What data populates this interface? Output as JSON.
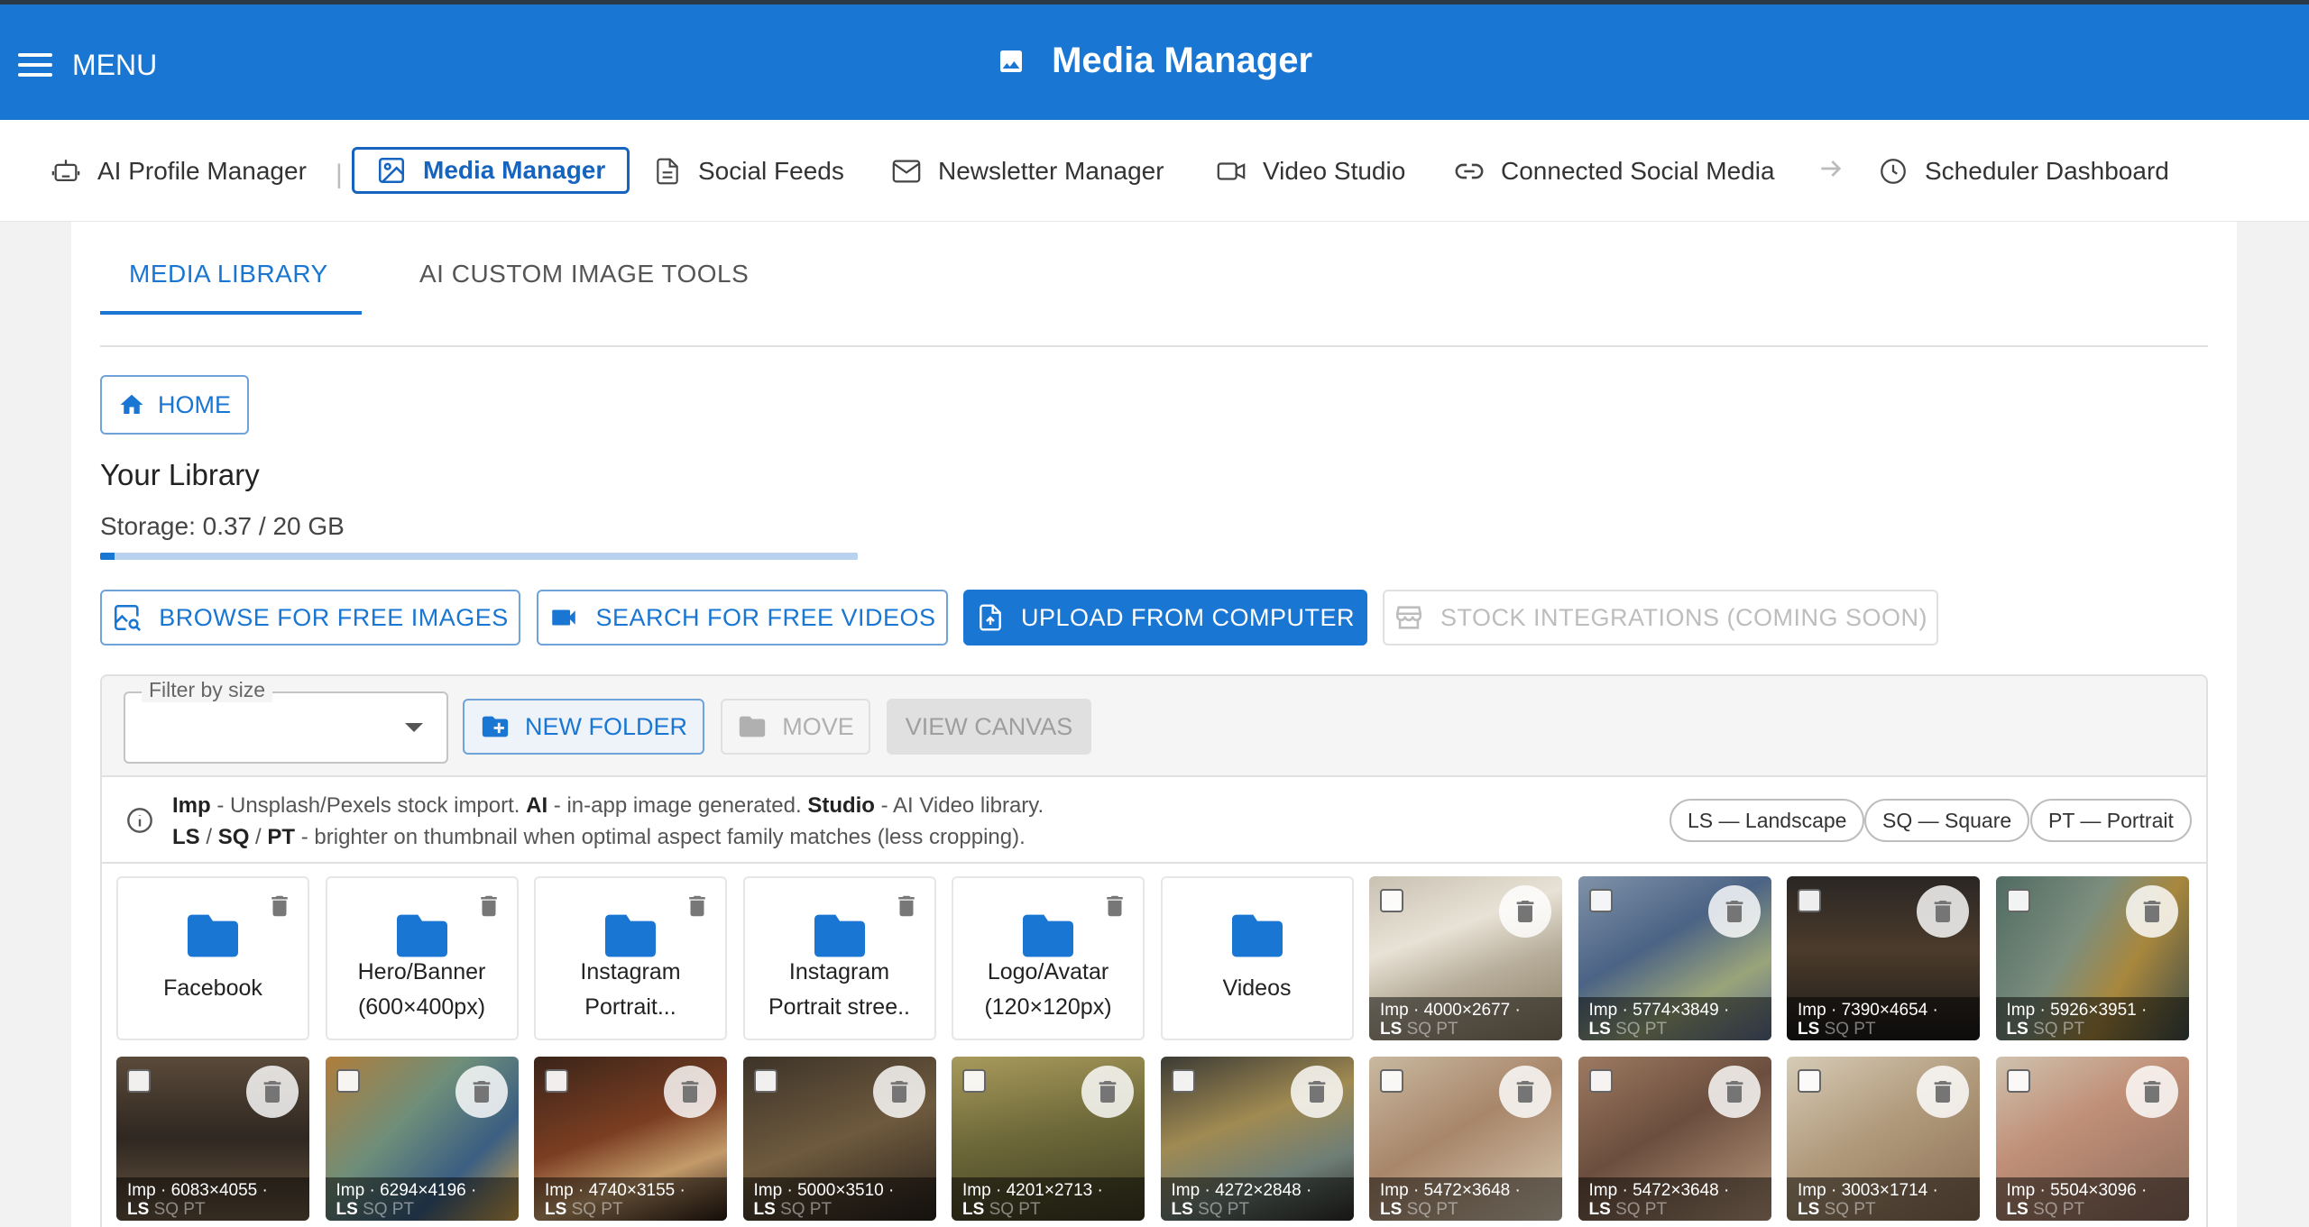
{
  "topbar": {
    "menu_label": "MENU",
    "title": "Media Manager"
  },
  "nav": {
    "items": [
      {
        "label": "AI Profile Manager",
        "icon": "robot-icon"
      },
      {
        "label": "Media Manager",
        "icon": "image-icon",
        "active": true
      },
      {
        "label": "Social Feeds",
        "icon": "document-icon"
      },
      {
        "label": "Newsletter Manager",
        "icon": "mail-icon"
      },
      {
        "label": "Video Studio",
        "icon": "video-camera-icon"
      },
      {
        "label": "Connected Social Media",
        "icon": "link-icon"
      },
      {
        "label": "Scheduler Dashboard",
        "icon": "clock-icon"
      }
    ]
  },
  "tabs": [
    {
      "label": "MEDIA LIBRARY",
      "active": true
    },
    {
      "label": "AI CUSTOM IMAGE TOOLS",
      "active": false
    }
  ],
  "home_label": "HOME",
  "library": {
    "title": "Your Library",
    "storage_text": "Storage: 0.37 / 20 GB",
    "storage_used_fraction": 0.0185
  },
  "actions": {
    "browse": "BROWSE FOR FREE IMAGES",
    "search_videos": "SEARCH FOR FREE VIDEOS",
    "upload": "UPLOAD FROM COMPUTER",
    "stock": "STOCK INTEGRATIONS (COMING SOON)"
  },
  "toolbar": {
    "filter_label": "Filter by size",
    "filter_value": "",
    "new_folder": "NEW FOLDER",
    "move": "MOVE",
    "view_canvas": "VIEW CANVAS"
  },
  "legend": {
    "imp": "Imp",
    "imp_desc": " - Unsplash/Pexels stock import. ",
    "ai": "AI",
    "ai_desc": " - in-app image generated. ",
    "studio": "Studio",
    "studio_desc": " - AI Video library.",
    "ls": "LS",
    "sep1": " / ",
    "sq": "SQ",
    "sep2": " / ",
    "pt": "PT",
    "fam_desc": " - brighter on thumbnail when optimal aspect family matches (less cropping).",
    "chips": [
      "LS — Landscape",
      "SQ — Square",
      "PT — Portrait"
    ]
  },
  "folders": [
    {
      "line1": "Facebook",
      "line2": ""
    },
    {
      "line1": "Hero/Banner",
      "line2": "(600×400px)"
    },
    {
      "line1": "Instagram",
      "line2": "Portrait..."
    },
    {
      "line1": "Instagram",
      "line2": "Portrait stree.."
    },
    {
      "line1": "Logo/Avatar",
      "line2": "(120×120px)"
    },
    {
      "line1": "Videos",
      "line2": ""
    }
  ],
  "images": [
    {
      "source": "Imp",
      "size": "4000×2677",
      "bg": "linear-gradient(160deg,#c9c1b2 0%,#e8e2d6 35%,#b7ad9a 60%,#8c7f66 100%)"
    },
    {
      "source": "Imp",
      "size": "5774×3849",
      "bg": "linear-gradient(150deg,#7f92a8 0%,#4b6385 40%,#9aa47a 70%,#5c6b8c 100%)"
    },
    {
      "source": "Imp",
      "size": "7390×4654",
      "bg": "linear-gradient(180deg,#2a2624 0%,#4b3b2b 45%,#1c1a19 100%)"
    },
    {
      "source": "Imp",
      "size": "5926×3951",
      "bg": "linear-gradient(120deg,#4f6b63 0%,#7d8e7d 40%,#a8873d 65%,#3f4c48 100%)"
    },
    {
      "source": "Imp",
      "size": "6083×4055",
      "bg": "linear-gradient(180deg,#5a4a3a 0%,#2f2721 50%,#6a5742 100%)"
    },
    {
      "source": "Imp",
      "size": "6294×4196",
      "bg": "linear-gradient(135deg,#b07d3a 0%,#6e8e7a 40%,#3b5e82 70%,#d6a54a 100%)"
    },
    {
      "source": "Imp",
      "size": "4740×3155",
      "bg": "linear-gradient(160deg,#3a2419 0%,#7b3e22 45%,#c39a6a 70%,#2b1b14 100%)"
    },
    {
      "source": "Imp",
      "size": "5000×3510",
      "bg": "linear-gradient(160deg,#3c3328 0%,#6e5a3e 50%,#2a231c 100%)"
    },
    {
      "source": "Imp",
      "size": "4201×2713",
      "bg": "linear-gradient(170deg,#a89a5c 0%,#6f6a3a 45%,#3e3b22 100%)"
    },
    {
      "source": "Imp",
      "size": "4272×2848",
      "bg": "linear-gradient(160deg,#3b3a34 0%,#a08a52 40%,#6e7e76 70%,#2e2d29 100%)"
    },
    {
      "source": "Imp",
      "size": "5472×3648",
      "bg": "linear-gradient(150deg,#c9b9a0 0%,#a8866a 45%,#d8cab2 100%)"
    },
    {
      "source": "Imp",
      "size": "5472×3648",
      "bg": "linear-gradient(150deg,#9d7a61 0%,#6b4e3e 45%,#b99a7f 100%)"
    },
    {
      "source": "Imp",
      "size": "3003×1714",
      "bg": "linear-gradient(150deg,#d6cbb6 0%,#b19a7c 45%,#8b6f54 100%)"
    },
    {
      "source": "Imp",
      "size": "5504×3096",
      "bg": "linear-gradient(150deg,#cfc2ae 0%,#c08f77 40%,#8d6e5e 100%)"
    }
  ],
  "family_tags": {
    "ls": "LS",
    "sq": "SQ",
    "pt": "PT"
  }
}
